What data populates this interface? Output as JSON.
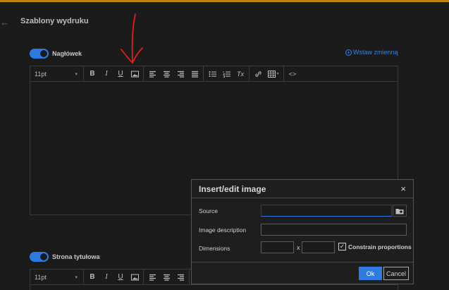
{
  "page": {
    "title": "Szablony wydruku",
    "back_icon": "arrow-left-icon",
    "accent_color": "#2f7be0",
    "top_bar_color": "#b8860b"
  },
  "sections": {
    "header": {
      "label": "Nagłówek",
      "toggle_on": true,
      "insert_variable": "Wstaw zmienną"
    },
    "title_page": {
      "label": "Strona tytułowa",
      "toggle_on": true
    }
  },
  "toolbar": {
    "font_size": "11pt",
    "icons": [
      "bold-icon",
      "italic-icon",
      "underline-icon",
      "image-icon",
      "align-left-icon",
      "align-center-icon",
      "align-right-icon",
      "align-justify-icon",
      "bullet-list-icon",
      "numbered-list-icon",
      "clear-format-icon",
      "link-icon",
      "table-icon",
      "code-icon"
    ],
    "bold": "B",
    "italic": "I",
    "underline": "U",
    "clear_format": "Tx",
    "code": "<>"
  },
  "dialog": {
    "title": "Insert/edit image",
    "close": "×",
    "source_label": "Source",
    "source_value": "",
    "description_label": "Image description",
    "description_value": "",
    "dimensions_label": "Dimensions",
    "width_value": "",
    "height_value": "",
    "x_separator": "x",
    "constrain_label": "Constrain proportions",
    "constrain_checked": true,
    "checkmark": "✓",
    "ok_label": "Ok",
    "cancel_label": "Cancel"
  },
  "annotation": {
    "color": "#e02020"
  }
}
